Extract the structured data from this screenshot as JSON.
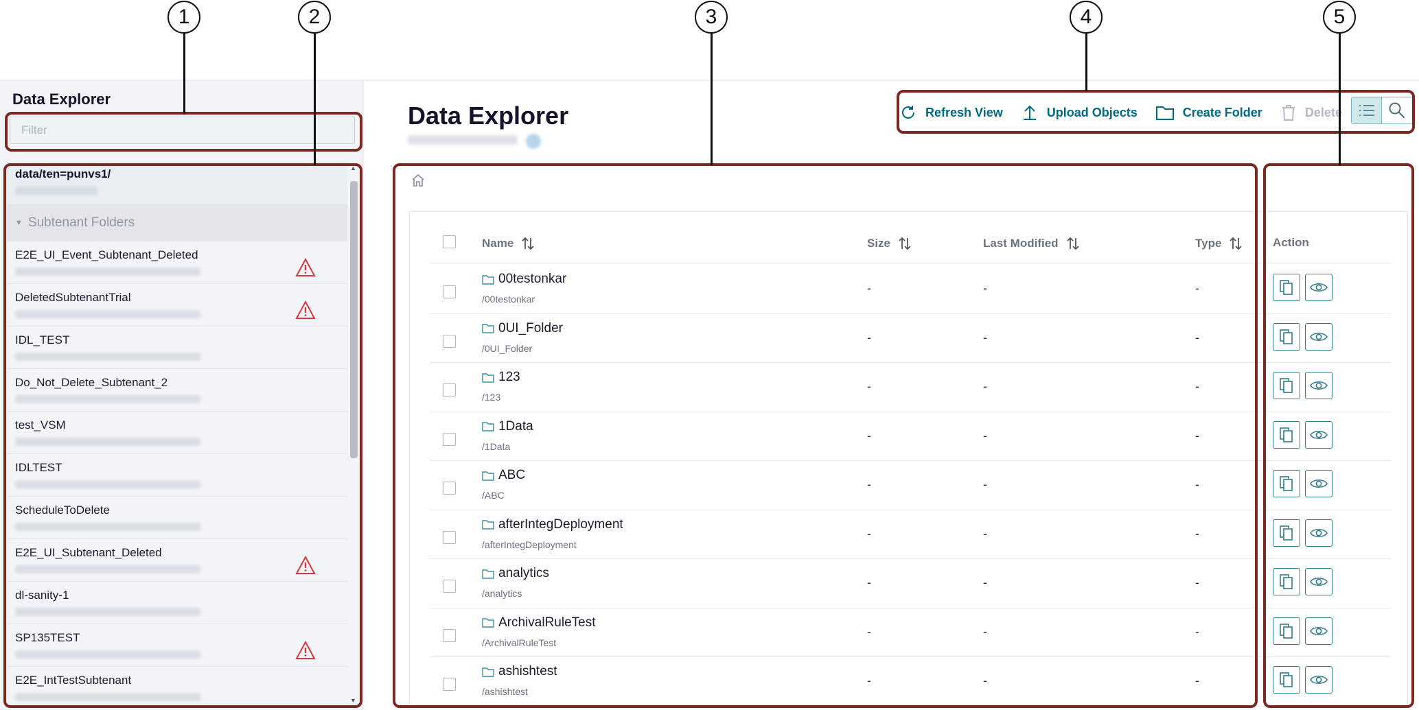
{
  "callouts": [
    "1",
    "2",
    "3",
    "4",
    "5"
  ],
  "sidebar": {
    "title": "Data Explorer",
    "filter_placeholder": "Filter",
    "root_label": "data/ten=punvs1/",
    "group_label": "Subtenant Folders",
    "items": [
      {
        "label": "E2E_UI_Event_Subtenant_Deleted",
        "warning": true
      },
      {
        "label": "DeletedSubtenantTrial",
        "warning": true
      },
      {
        "label": "IDL_TEST",
        "warning": false
      },
      {
        "label": "Do_Not_Delete_Subtenant_2",
        "warning": false
      },
      {
        "label": "test_VSM",
        "warning": false
      },
      {
        "label": "IDLTEST",
        "warning": false
      },
      {
        "label": "ScheduleToDelete",
        "warning": false
      },
      {
        "label": "E2E_UI_Subtenant_Deleted",
        "warning": true
      },
      {
        "label": "dl-sanity-1",
        "warning": false
      },
      {
        "label": "SP135TEST",
        "warning": true
      },
      {
        "label": "E2E_IntTestSubtenant",
        "warning": false
      }
    ]
  },
  "main": {
    "title": "Data Explorer",
    "toolbar": {
      "refresh": "Refresh View",
      "upload": "Upload Objects",
      "create": "Create Folder",
      "delete": "Delete"
    },
    "columns": {
      "name": "Name",
      "size": "Size",
      "modified": "Last Modified",
      "type": "Type",
      "action": "Action"
    },
    "rows": [
      {
        "name": "00testonkar",
        "path": "/00testonkar",
        "size": "-",
        "modified": "-",
        "type": "-"
      },
      {
        "name": "0UI_Folder",
        "path": "/0UI_Folder",
        "size": "-",
        "modified": "-",
        "type": "-"
      },
      {
        "name": "123",
        "path": "/123",
        "size": "-",
        "modified": "-",
        "type": "-"
      },
      {
        "name": "1Data",
        "path": "/1Data",
        "size": "-",
        "modified": "-",
        "type": "-"
      },
      {
        "name": "ABC",
        "path": "/ABC",
        "size": "-",
        "modified": "-",
        "type": "-"
      },
      {
        "name": "afterIntegDeployment",
        "path": "/afterIntegDeployment",
        "size": "-",
        "modified": "-",
        "type": "-"
      },
      {
        "name": "analytics",
        "path": "/analytics",
        "size": "-",
        "modified": "-",
        "type": "-"
      },
      {
        "name": "ArchivalRuleTest",
        "path": "/ArchivalRuleTest",
        "size": "-",
        "modified": "-",
        "type": "-"
      },
      {
        "name": "ashishtest",
        "path": "/ashishtest",
        "size": "-",
        "modified": "-",
        "type": "-"
      }
    ]
  },
  "colors": {
    "accent": "#006a85",
    "annotation_frame": "#7a2a22",
    "warning": "#d9363e"
  }
}
